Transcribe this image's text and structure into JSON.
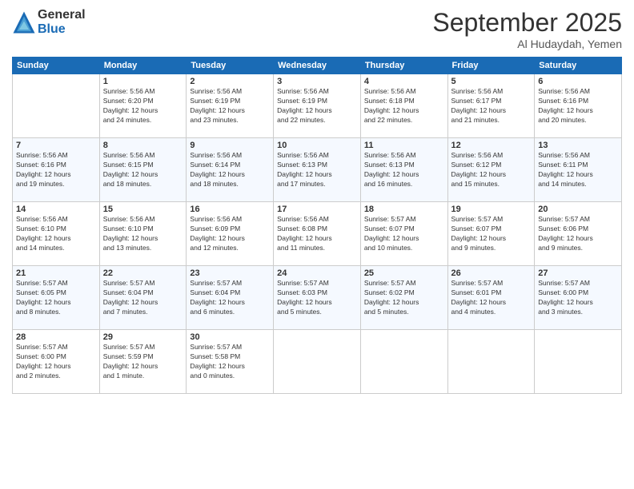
{
  "logo": {
    "general": "General",
    "blue": "Blue"
  },
  "title": "September 2025",
  "location": "Al Hudaydah, Yemen",
  "days_of_week": [
    "Sunday",
    "Monday",
    "Tuesday",
    "Wednesday",
    "Thursday",
    "Friday",
    "Saturday"
  ],
  "weeks": [
    [
      {
        "day": "",
        "info": ""
      },
      {
        "day": "1",
        "info": "Sunrise: 5:56 AM\nSunset: 6:20 PM\nDaylight: 12 hours\nand 24 minutes."
      },
      {
        "day": "2",
        "info": "Sunrise: 5:56 AM\nSunset: 6:19 PM\nDaylight: 12 hours\nand 23 minutes."
      },
      {
        "day": "3",
        "info": "Sunrise: 5:56 AM\nSunset: 6:19 PM\nDaylight: 12 hours\nand 22 minutes."
      },
      {
        "day": "4",
        "info": "Sunrise: 5:56 AM\nSunset: 6:18 PM\nDaylight: 12 hours\nand 22 minutes."
      },
      {
        "day": "5",
        "info": "Sunrise: 5:56 AM\nSunset: 6:17 PM\nDaylight: 12 hours\nand 21 minutes."
      },
      {
        "day": "6",
        "info": "Sunrise: 5:56 AM\nSunset: 6:16 PM\nDaylight: 12 hours\nand 20 minutes."
      }
    ],
    [
      {
        "day": "7",
        "info": "Sunrise: 5:56 AM\nSunset: 6:16 PM\nDaylight: 12 hours\nand 19 minutes."
      },
      {
        "day": "8",
        "info": "Sunrise: 5:56 AM\nSunset: 6:15 PM\nDaylight: 12 hours\nand 18 minutes."
      },
      {
        "day": "9",
        "info": "Sunrise: 5:56 AM\nSunset: 6:14 PM\nDaylight: 12 hours\nand 18 minutes."
      },
      {
        "day": "10",
        "info": "Sunrise: 5:56 AM\nSunset: 6:13 PM\nDaylight: 12 hours\nand 17 minutes."
      },
      {
        "day": "11",
        "info": "Sunrise: 5:56 AM\nSunset: 6:13 PM\nDaylight: 12 hours\nand 16 minutes."
      },
      {
        "day": "12",
        "info": "Sunrise: 5:56 AM\nSunset: 6:12 PM\nDaylight: 12 hours\nand 15 minutes."
      },
      {
        "day": "13",
        "info": "Sunrise: 5:56 AM\nSunset: 6:11 PM\nDaylight: 12 hours\nand 14 minutes."
      }
    ],
    [
      {
        "day": "14",
        "info": "Sunrise: 5:56 AM\nSunset: 6:10 PM\nDaylight: 12 hours\nand 14 minutes."
      },
      {
        "day": "15",
        "info": "Sunrise: 5:56 AM\nSunset: 6:10 PM\nDaylight: 12 hours\nand 13 minutes."
      },
      {
        "day": "16",
        "info": "Sunrise: 5:56 AM\nSunset: 6:09 PM\nDaylight: 12 hours\nand 12 minutes."
      },
      {
        "day": "17",
        "info": "Sunrise: 5:56 AM\nSunset: 6:08 PM\nDaylight: 12 hours\nand 11 minutes."
      },
      {
        "day": "18",
        "info": "Sunrise: 5:57 AM\nSunset: 6:07 PM\nDaylight: 12 hours\nand 10 minutes."
      },
      {
        "day": "19",
        "info": "Sunrise: 5:57 AM\nSunset: 6:07 PM\nDaylight: 12 hours\nand 9 minutes."
      },
      {
        "day": "20",
        "info": "Sunrise: 5:57 AM\nSunset: 6:06 PM\nDaylight: 12 hours\nand 9 minutes."
      }
    ],
    [
      {
        "day": "21",
        "info": "Sunrise: 5:57 AM\nSunset: 6:05 PM\nDaylight: 12 hours\nand 8 minutes."
      },
      {
        "day": "22",
        "info": "Sunrise: 5:57 AM\nSunset: 6:04 PM\nDaylight: 12 hours\nand 7 minutes."
      },
      {
        "day": "23",
        "info": "Sunrise: 5:57 AM\nSunset: 6:04 PM\nDaylight: 12 hours\nand 6 minutes."
      },
      {
        "day": "24",
        "info": "Sunrise: 5:57 AM\nSunset: 6:03 PM\nDaylight: 12 hours\nand 5 minutes."
      },
      {
        "day": "25",
        "info": "Sunrise: 5:57 AM\nSunset: 6:02 PM\nDaylight: 12 hours\nand 5 minutes."
      },
      {
        "day": "26",
        "info": "Sunrise: 5:57 AM\nSunset: 6:01 PM\nDaylight: 12 hours\nand 4 minutes."
      },
      {
        "day": "27",
        "info": "Sunrise: 5:57 AM\nSunset: 6:00 PM\nDaylight: 12 hours\nand 3 minutes."
      }
    ],
    [
      {
        "day": "28",
        "info": "Sunrise: 5:57 AM\nSunset: 6:00 PM\nDaylight: 12 hours\nand 2 minutes."
      },
      {
        "day": "29",
        "info": "Sunrise: 5:57 AM\nSunset: 5:59 PM\nDaylight: 12 hours\nand 1 minute."
      },
      {
        "day": "30",
        "info": "Sunrise: 5:57 AM\nSunset: 5:58 PM\nDaylight: 12 hours\nand 0 minutes."
      },
      {
        "day": "",
        "info": ""
      },
      {
        "day": "",
        "info": ""
      },
      {
        "day": "",
        "info": ""
      },
      {
        "day": "",
        "info": ""
      }
    ]
  ]
}
